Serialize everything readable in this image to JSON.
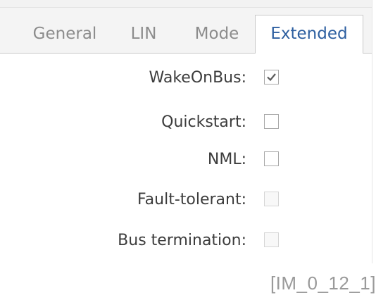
{
  "tabs": [
    {
      "label": "General",
      "active": false
    },
    {
      "label": "LIN",
      "active": false
    },
    {
      "label": "Mode",
      "active": false
    },
    {
      "label": "Extended",
      "active": true
    }
  ],
  "extended": {
    "options": [
      {
        "label": "WakeOnBus:",
        "checked": true,
        "enabled": true
      },
      {
        "label": "Quickstart:",
        "checked": false,
        "enabled": true
      },
      {
        "label": "NML:",
        "checked": false,
        "enabled": true
      },
      {
        "label": "Fault-tolerant:",
        "checked": false,
        "enabled": false
      },
      {
        "label": "Bus termination:",
        "checked": false,
        "enabled": false
      }
    ]
  },
  "caption": "[IM_0_12_1]",
  "colors": {
    "active_tab_text": "#2d5fa0",
    "inactive_tab_text": "#8c8c8c",
    "label_text": "#3c3c3c",
    "checkmark": "#5a5a5a"
  },
  "icons": {
    "checkmark": "check-icon"
  }
}
